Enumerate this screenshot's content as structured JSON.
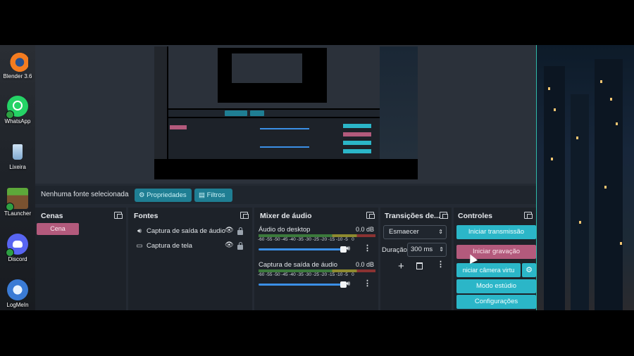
{
  "desktop_icons": [
    {
      "label": "Blender 3.6",
      "icon": "blender-icon",
      "color": "#f47c20"
    },
    {
      "label": "WhatsApp",
      "icon": "whatsapp-icon",
      "color": "#25d366"
    },
    {
      "label": "Lixeira",
      "icon": "recycle-bin-icon",
      "color": "#7fb6e8"
    },
    {
      "label": "TLauncher",
      "icon": "tlauncher-icon",
      "color": "#4f8d2a"
    },
    {
      "label": "Discord",
      "icon": "discord-icon",
      "color": "#5865f2"
    },
    {
      "label": "LogMeIn",
      "icon": "logmein-icon",
      "color": "#3a7bd5"
    }
  ],
  "source_bar": {
    "status": "Nenhuma fonte selecionada",
    "properties_label": "Propriedades",
    "filters_label": "Filtros"
  },
  "panels": {
    "scenes": {
      "title": "Cenas",
      "items": [
        "Cena"
      ]
    },
    "sources": {
      "title": "Fontes",
      "items": [
        {
          "label": "Captura de saída de áudio",
          "icon": "speaker-icon"
        },
        {
          "label": "Captura de tela",
          "icon": "monitor-icon"
        }
      ]
    },
    "mixer": {
      "title": "Mixer de áudio",
      "scale": [
        "-60",
        "-55",
        "-50",
        "-45",
        "-40",
        "-35",
        "-30",
        "-25",
        "-20",
        "-15",
        "-10",
        "-5",
        "0"
      ],
      "channels": [
        {
          "name": "Áudio do desktop",
          "db": "0.0 dB",
          "volume": 0.95
        },
        {
          "name": "Captura de saída de áudio",
          "db": "0.0 dB",
          "volume": 0.95
        }
      ]
    },
    "transitions": {
      "title": "Transições de...",
      "selected": "Esmaecer",
      "duration_label": "Duração",
      "duration_value": "300 ms"
    },
    "controls": {
      "title": "Controles",
      "buttons": [
        "Iniciar transmissão",
        "Iniciar gravação",
        "niciar câmera virtu",
        "Modo estúdio",
        "Configurações"
      ]
    }
  },
  "colors": {
    "accent": "#2bb6c8",
    "recording": "#b35a7c",
    "scene_selected": "#b35a7c",
    "separator": "#2fb9a8"
  }
}
